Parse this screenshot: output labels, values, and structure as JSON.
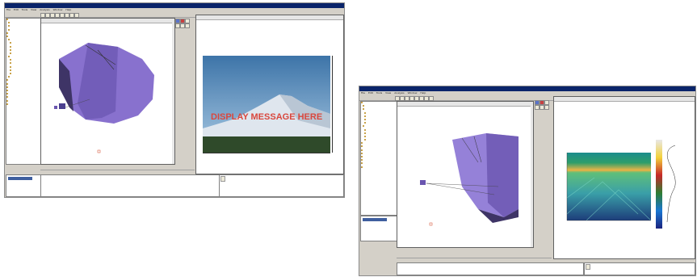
{
  "left_window": {
    "title_text": "",
    "menu": [
      "File",
      "Edit",
      "Tools",
      "View",
      "Analysis",
      "Window",
      "Help"
    ],
    "plot_title": "",
    "plot_subtitle": "",
    "overlay_message": "DISPLAY MESSAGE HERE",
    "tabs": [
      "",
      ""
    ]
  },
  "right_window": {
    "title_text": "",
    "menu": [
      "File",
      "Edit",
      "Tools",
      "View",
      "Analysis",
      "Window",
      "Help"
    ],
    "plot_title": "",
    "plot_subtitle": "",
    "tabs": [
      "",
      ""
    ]
  },
  "colors": {
    "titlebar": "#0a246a",
    "shape_purple": "#7b62c9",
    "heatmap_low": "#1a237e",
    "heatmap_high": "#c62828"
  }
}
